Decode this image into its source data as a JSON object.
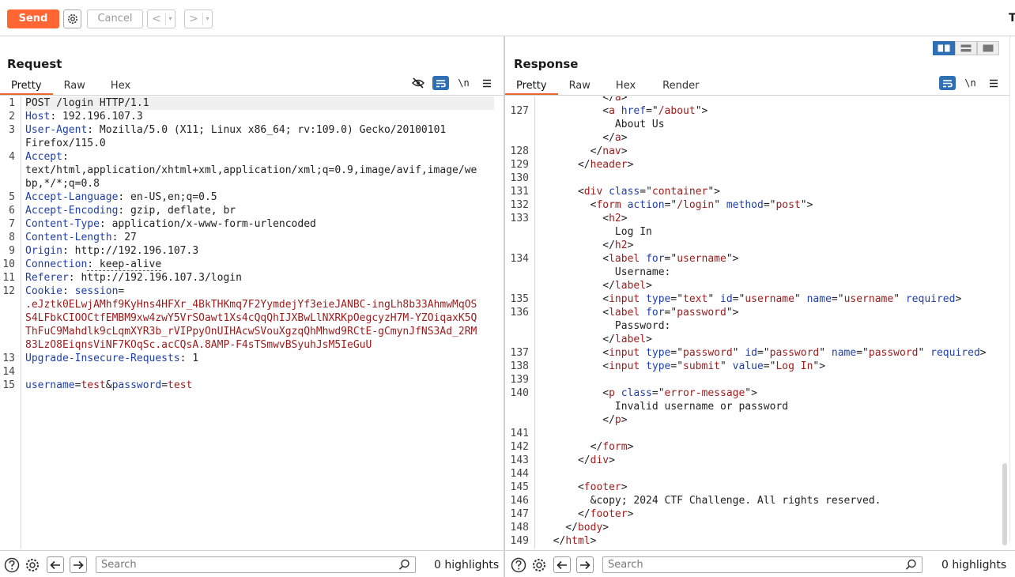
{
  "toolbar": {
    "send_label": "Send",
    "cancel_label": "Cancel",
    "back_glyph": "<",
    "forward_glyph": ">",
    "dropdown_glyph": "▾",
    "right_clip": "T"
  },
  "request": {
    "title": "Request",
    "tabs": [
      "Pretty",
      "Raw",
      "Hex"
    ],
    "active_tab": "Pretty",
    "tools": {
      "hide_icon": "eye-off-icon",
      "wrap_icon": "wrap-icon",
      "newline": "\\n",
      "menu_icon": "menu-icon"
    },
    "lines": [
      {
        "n": "1",
        "segs": [
          [
            "c",
            "POST /login HTTP/1.1"
          ]
        ]
      },
      {
        "n": "2",
        "segs": [
          [
            "k",
            "Host"
          ],
          [
            "c",
            ": 192.196.107.3"
          ]
        ]
      },
      {
        "n": "3",
        "segs": [
          [
            "k",
            "User-Agent"
          ],
          [
            "c",
            ": Mozilla/5.0 (X11; Linux x86_64; rv:109.0) Gecko/20100101"
          ]
        ]
      },
      {
        "n": "",
        "segs": [
          [
            "c",
            "Firefox/115.0"
          ]
        ]
      },
      {
        "n": "4",
        "segs": [
          [
            "k",
            "Accept"
          ],
          [
            "c",
            ":"
          ]
        ]
      },
      {
        "n": "",
        "segs": [
          [
            "c",
            "text/html,application/xhtml+xml,application/xml;q=0.9,image/avif,image/we"
          ]
        ]
      },
      {
        "n": "",
        "segs": [
          [
            "c",
            "bp,*/*;q=0.8"
          ]
        ]
      },
      {
        "n": "5",
        "segs": [
          [
            "k",
            "Accept-Language"
          ],
          [
            "c",
            ": en-US,en;q=0.5"
          ]
        ]
      },
      {
        "n": "6",
        "segs": [
          [
            "k",
            "Accept-Encoding"
          ],
          [
            "c",
            ": gzip, deflate, br"
          ]
        ]
      },
      {
        "n": "7",
        "segs": [
          [
            "k",
            "Content-Type"
          ],
          [
            "c",
            ": application/x-www-form-urlencoded"
          ]
        ]
      },
      {
        "n": "8",
        "segs": [
          [
            "k",
            "Content-Length"
          ],
          [
            "c",
            ": 27"
          ]
        ]
      },
      {
        "n": "9",
        "segs": [
          [
            "k",
            "Origin"
          ],
          [
            "c",
            ": http://192.196.107.3"
          ]
        ]
      },
      {
        "n": "10",
        "segs": [
          [
            "k",
            "Connection"
          ],
          [
            "c",
            ": keep-alive"
          ]
        ]
      },
      {
        "n": "11",
        "segs": [
          [
            "k",
            "Referer"
          ],
          [
            "c",
            ": http://192.196.107.3/login"
          ]
        ]
      },
      {
        "n": "12",
        "segs": [
          [
            "k",
            "Cookie"
          ],
          [
            "c",
            ": "
          ],
          [
            "k",
            "session"
          ],
          [
            "c",
            "="
          ]
        ]
      },
      {
        "n": "",
        "segs": [
          [
            "v",
            ".eJztk0ELwjAMhf9KyHns4HFXr_4BkTHKmq7F2YymdejYf3eieJANBC-ingLh8b33AhmwMqOS"
          ]
        ]
      },
      {
        "n": "",
        "segs": [
          [
            "v",
            "S4LFbkCIOOCtfEMBM9xw4zwY5VrSOawt1Xs4cQqQhIJXBwLlNXRKpOegcyzH7M-YZOiqaxK5Q"
          ]
        ]
      },
      {
        "n": "",
        "segs": [
          [
            "v",
            "ThFuC9Mahdlk9cLqmXYR3b_rVIPpyOnUIHAcwSVouXgzqQhMhwd9RCtE-gCmynJfNS3Ad_2RM"
          ]
        ]
      },
      {
        "n": "",
        "segs": [
          [
            "v",
            "83LzO8EiqnsViNF7KOqSc.acCQsA.8AMP-F4sTSmwvBSyuhJsM5IeGuU"
          ]
        ]
      },
      {
        "n": "13",
        "segs": [
          [
            "k",
            "Upgrade-Insecure-Requests"
          ],
          [
            "c",
            ": 1"
          ]
        ]
      },
      {
        "n": "14",
        "segs": [
          [
            "c",
            ""
          ]
        ]
      },
      {
        "n": "15",
        "segs": [
          [
            "k",
            "username"
          ],
          [
            "c",
            "="
          ],
          [
            "v",
            "test"
          ],
          [
            "c",
            "&"
          ],
          [
            "k",
            "password"
          ],
          [
            "c",
            "="
          ],
          [
            "v",
            "test"
          ]
        ]
      }
    ],
    "search_placeholder": "Search",
    "highlights": "0 highlights"
  },
  "response": {
    "title": "Response",
    "tabs": [
      "Pretty",
      "Raw",
      "Hex",
      "Render"
    ],
    "active_tab": "Pretty",
    "tools": {
      "wrap_icon": "wrap-icon",
      "newline": "\\n",
      "menu_icon": "menu-icon"
    },
    "lines": [
      {
        "n": "",
        "segs": [
          [
            "c",
            "          </"
          ],
          [
            "t",
            "a"
          ],
          [
            "c",
            ">"
          ]
        ]
      },
      {
        "n": "127",
        "segs": [
          [
            "c",
            "          <"
          ],
          [
            "t",
            "a"
          ],
          [
            "c",
            " "
          ],
          [
            "k",
            "href"
          ],
          [
            "c",
            "=\""
          ],
          [
            "v",
            "/about"
          ],
          [
            "c",
            "\">"
          ]
        ]
      },
      {
        "n": "",
        "segs": [
          [
            "c",
            "            About Us"
          ]
        ]
      },
      {
        "n": "",
        "segs": [
          [
            "c",
            "          </"
          ],
          [
            "t",
            "a"
          ],
          [
            "c",
            ">"
          ]
        ]
      },
      {
        "n": "128",
        "segs": [
          [
            "c",
            "        </"
          ],
          [
            "t",
            "nav"
          ],
          [
            "c",
            ">"
          ]
        ]
      },
      {
        "n": "129",
        "segs": [
          [
            "c",
            "      </"
          ],
          [
            "t",
            "header"
          ],
          [
            "c",
            ">"
          ]
        ]
      },
      {
        "n": "130",
        "segs": [
          [
            "c",
            ""
          ]
        ]
      },
      {
        "n": "131",
        "segs": [
          [
            "c",
            "      <"
          ],
          [
            "t",
            "div"
          ],
          [
            "c",
            " "
          ],
          [
            "k",
            "class"
          ],
          [
            "c",
            "=\""
          ],
          [
            "v",
            "container"
          ],
          [
            "c",
            "\">"
          ]
        ]
      },
      {
        "n": "132",
        "segs": [
          [
            "c",
            "        <"
          ],
          [
            "t",
            "form"
          ],
          [
            "c",
            " "
          ],
          [
            "k",
            "action"
          ],
          [
            "c",
            "=\""
          ],
          [
            "v",
            "/login"
          ],
          [
            "c",
            "\" "
          ],
          [
            "k",
            "method"
          ],
          [
            "c",
            "=\""
          ],
          [
            "v",
            "post"
          ],
          [
            "c",
            "\">"
          ]
        ]
      },
      {
        "n": "133",
        "segs": [
          [
            "c",
            "          <"
          ],
          [
            "t",
            "h2"
          ],
          [
            "c",
            ">"
          ]
        ]
      },
      {
        "n": "",
        "segs": [
          [
            "c",
            "            Log In"
          ]
        ]
      },
      {
        "n": "",
        "segs": [
          [
            "c",
            "          </"
          ],
          [
            "t",
            "h2"
          ],
          [
            "c",
            ">"
          ]
        ]
      },
      {
        "n": "134",
        "segs": [
          [
            "c",
            "          <"
          ],
          [
            "t",
            "label"
          ],
          [
            "c",
            " "
          ],
          [
            "k",
            "for"
          ],
          [
            "c",
            "=\""
          ],
          [
            "v",
            "username"
          ],
          [
            "c",
            "\">"
          ]
        ]
      },
      {
        "n": "",
        "segs": [
          [
            "c",
            "            Username:"
          ]
        ]
      },
      {
        "n": "",
        "segs": [
          [
            "c",
            "          </"
          ],
          [
            "t",
            "label"
          ],
          [
            "c",
            ">"
          ]
        ]
      },
      {
        "n": "135",
        "segs": [
          [
            "c",
            "          <"
          ],
          [
            "t",
            "input"
          ],
          [
            "c",
            " "
          ],
          [
            "k",
            "type"
          ],
          [
            "c",
            "=\""
          ],
          [
            "v",
            "text"
          ],
          [
            "c",
            "\" "
          ],
          [
            "k",
            "id"
          ],
          [
            "c",
            "=\""
          ],
          [
            "v",
            "username"
          ],
          [
            "c",
            "\" "
          ],
          [
            "k",
            "name"
          ],
          [
            "c",
            "=\""
          ],
          [
            "v",
            "username"
          ],
          [
            "c",
            "\" "
          ],
          [
            "k",
            "required"
          ],
          [
            "c",
            ">"
          ]
        ]
      },
      {
        "n": "136",
        "segs": [
          [
            "c",
            "          <"
          ],
          [
            "t",
            "label"
          ],
          [
            "c",
            " "
          ],
          [
            "k",
            "for"
          ],
          [
            "c",
            "=\""
          ],
          [
            "v",
            "password"
          ],
          [
            "c",
            "\">"
          ]
        ]
      },
      {
        "n": "",
        "segs": [
          [
            "c",
            "            Password:"
          ]
        ]
      },
      {
        "n": "",
        "segs": [
          [
            "c",
            "          </"
          ],
          [
            "t",
            "label"
          ],
          [
            "c",
            ">"
          ]
        ]
      },
      {
        "n": "137",
        "segs": [
          [
            "c",
            "          <"
          ],
          [
            "t",
            "input"
          ],
          [
            "c",
            " "
          ],
          [
            "k",
            "type"
          ],
          [
            "c",
            "=\""
          ],
          [
            "v",
            "password"
          ],
          [
            "c",
            "\" "
          ],
          [
            "k",
            "id"
          ],
          [
            "c",
            "=\""
          ],
          [
            "v",
            "password"
          ],
          [
            "c",
            "\" "
          ],
          [
            "k",
            "name"
          ],
          [
            "c",
            "=\""
          ],
          [
            "v",
            "password"
          ],
          [
            "c",
            "\" "
          ],
          [
            "k",
            "required"
          ],
          [
            "c",
            ">"
          ]
        ]
      },
      {
        "n": "138",
        "segs": [
          [
            "c",
            "          <"
          ],
          [
            "t",
            "input"
          ],
          [
            "c",
            " "
          ],
          [
            "k",
            "type"
          ],
          [
            "c",
            "=\""
          ],
          [
            "v",
            "submit"
          ],
          [
            "c",
            "\" "
          ],
          [
            "k",
            "value"
          ],
          [
            "c",
            "=\""
          ],
          [
            "v",
            "Log In"
          ],
          [
            "c",
            "\">"
          ]
        ]
      },
      {
        "n": "139",
        "segs": [
          [
            "c",
            ""
          ]
        ]
      },
      {
        "n": "140",
        "segs": [
          [
            "c",
            "          <"
          ],
          [
            "t",
            "p"
          ],
          [
            "c",
            " "
          ],
          [
            "k",
            "class"
          ],
          [
            "c",
            "=\""
          ],
          [
            "v",
            "error-message"
          ],
          [
            "c",
            "\">"
          ]
        ]
      },
      {
        "n": "",
        "segs": [
          [
            "c",
            "            Invalid username or password"
          ]
        ]
      },
      {
        "n": "",
        "segs": [
          [
            "c",
            "          </"
          ],
          [
            "t",
            "p"
          ],
          [
            "c",
            ">"
          ]
        ]
      },
      {
        "n": "141",
        "segs": [
          [
            "c",
            ""
          ]
        ]
      },
      {
        "n": "142",
        "segs": [
          [
            "c",
            "        </"
          ],
          [
            "t",
            "form"
          ],
          [
            "c",
            ">"
          ]
        ]
      },
      {
        "n": "143",
        "segs": [
          [
            "c",
            "      </"
          ],
          [
            "t",
            "div"
          ],
          [
            "c",
            ">"
          ]
        ]
      },
      {
        "n": "144",
        "segs": [
          [
            "c",
            ""
          ]
        ]
      },
      {
        "n": "145",
        "segs": [
          [
            "c",
            "      <"
          ],
          [
            "t",
            "footer"
          ],
          [
            "c",
            ">"
          ]
        ]
      },
      {
        "n": "146",
        "segs": [
          [
            "c",
            "        &copy; 2024 CTF Challenge. All rights reserved."
          ]
        ]
      },
      {
        "n": "147",
        "segs": [
          [
            "c",
            "      </"
          ],
          [
            "t",
            "footer"
          ],
          [
            "c",
            ">"
          ]
        ]
      },
      {
        "n": "148",
        "segs": [
          [
            "c",
            "    </"
          ],
          [
            "t",
            "body"
          ],
          [
            "c",
            ">"
          ]
        ]
      },
      {
        "n": "149",
        "segs": [
          [
            "c",
            "  </"
          ],
          [
            "t",
            "html"
          ],
          [
            "c",
            ">"
          ]
        ]
      }
    ],
    "search_placeholder": "Search",
    "highlights": "0 highlights"
  },
  "colors": {
    "send": "#ff6633",
    "accent_blue": "#2f6fb3",
    "key": "#1f3fa8",
    "value": "#9b1b1b",
    "tab_underline": "#e9652a"
  }
}
